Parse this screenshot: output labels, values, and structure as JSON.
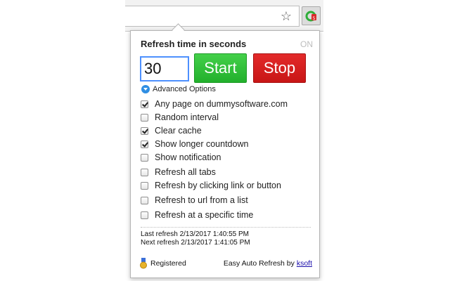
{
  "browser": {
    "star_glyph": "☆",
    "extension_icon": "easy-auto-refresh-icon"
  },
  "popup": {
    "title": "Refresh time in seconds",
    "status": "ON",
    "time_value": "30",
    "start_label": "Start",
    "stop_label": "Stop",
    "advanced_label": "Advanced Options",
    "options": [
      {
        "label": "Any page on dummysoftware.com",
        "checked": true
      },
      {
        "label": "Random interval",
        "checked": false
      },
      {
        "label": "Clear cache",
        "checked": true
      },
      {
        "label": "Show longer countdown",
        "checked": true
      },
      {
        "label": "Show notification",
        "checked": false
      },
      {
        "label": "Refresh all tabs",
        "checked": false
      },
      {
        "label": "Refresh by clicking link or button",
        "checked": false
      },
      {
        "label": "Refresh to url from a list",
        "checked": false
      },
      {
        "label": "Refresh at a specific time",
        "checked": false
      }
    ],
    "last_refresh": "Last refresh 2/13/2017 1:40:55 PM",
    "next_refresh": "Next refresh 2/13/2017 1:41:05 PM",
    "registered_label": "Registered",
    "credit_prefix": "Easy Auto Refresh by",
    "credit_link": "ksoft"
  },
  "colors": {
    "start": "#22b02c",
    "stop": "#c81616",
    "focus": "#4d90fe",
    "link": "#1a0dab"
  }
}
